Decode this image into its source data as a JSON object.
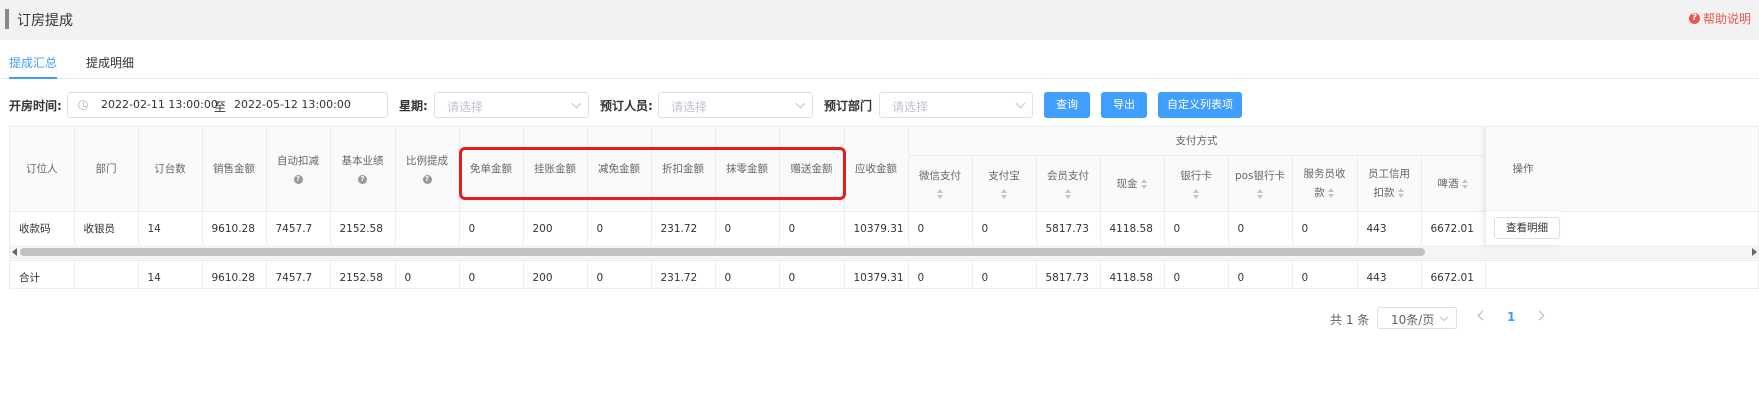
{
  "header": {
    "title": "订房提成",
    "help": "帮助说明"
  },
  "tabs": [
    {
      "label": "提成汇总"
    },
    {
      "label": "提成明细"
    }
  ],
  "filters": {
    "time_label": "开房时间:",
    "start": "2022-02-11 13:00:00",
    "sep": "至",
    "end": "2022-05-12 13:00:00",
    "weekday_label": "星期:",
    "weekday_placeholder": "请选择",
    "booker_label": "预订人员:",
    "booker_placeholder": "请选择",
    "dept_label": "预订部门",
    "dept_placeholder": "请选择",
    "btn_query": "查询",
    "btn_export": "导出",
    "btn_custom": "自定义列表项"
  },
  "table": {
    "columns": {
      "c1": "订位人",
      "c2": "部门",
      "c3": "订台数",
      "c4": "销售金额",
      "c5": "自动扣减",
      "c6": "基本业绩",
      "c7": "比例提成",
      "c8": "免单金额",
      "c9": "挂账金额",
      "c10": "减免金额",
      "c11": "折扣金额",
      "c12": "抹零金额",
      "c13": "赠送金额",
      "c14": "应收金额",
      "group": "支付方式",
      "c15": "微信支付",
      "c16": "支付宝",
      "c17": "会员支付",
      "c18": "现金",
      "c19": "银行卡",
      "c20": "pos银行卡",
      "c21a": "服务员收",
      "c21b": "款",
      "c22a": "员工信用",
      "c22b": "扣款",
      "c23": "啤酒",
      "op": "操作"
    },
    "row": [
      "收款码",
      "收银员",
      "14",
      "9610.28",
      "7457.7",
      "2152.58",
      "",
      "0",
      "200",
      "0",
      "231.72",
      "0",
      "0",
      "10379.31",
      "0",
      "0",
      "5817.73",
      "4118.58",
      "0",
      "0",
      "0",
      "443",
      "6672.01"
    ],
    "total": [
      "合计",
      "",
      "14",
      "9610.28",
      "7457.7",
      "2152.58",
      "0",
      "0",
      "200",
      "0",
      "231.72",
      "0",
      "0",
      "10379.31",
      "0",
      "0",
      "5817.73",
      "4118.58",
      "0",
      "0",
      "0",
      "443",
      "6672.01"
    ],
    "detail_btn": "查看明细"
  },
  "pagination": {
    "total": "共 1 条",
    "page_size": "10条/页",
    "current": "1"
  },
  "colors": {
    "primary": "#409eff",
    "highlight": "#e81c1c",
    "help": "#e85a4f"
  }
}
